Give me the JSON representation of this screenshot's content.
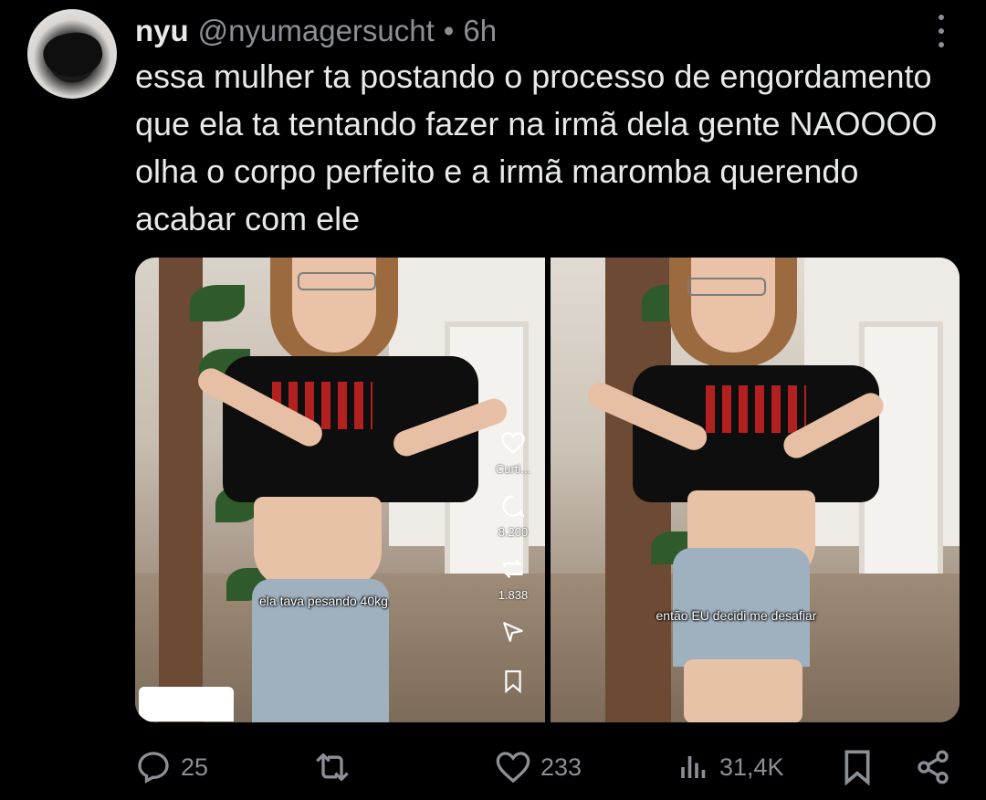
{
  "author": {
    "display_name": "nyu",
    "handle": "@nyumagersucht",
    "separator": "•",
    "time": "6h"
  },
  "tweet_text": "essa mulher ta postando o processo de engordamento que ela ta tentando fazer na irmã dela gente NAOOOO olha o corpo perfeito e a irmã maromba querendo acabar com ele",
  "media": {
    "left": {
      "caption": "ela tava pesando 40kg",
      "side_actions": [
        {
          "icon": "heart-icon",
          "label": "Curti..."
        },
        {
          "icon": "comment-icon",
          "label": "8.200"
        },
        {
          "icon": "repost-icon",
          "label": "1.838"
        },
        {
          "icon": "send-icon",
          "label": ""
        },
        {
          "icon": "bookmark-icon",
          "label": ""
        }
      ]
    },
    "right": {
      "caption": "então EU decidi me desafiar"
    }
  },
  "actions": {
    "replies": "25",
    "reposts": "",
    "likes": "233",
    "views": "31,4K"
  },
  "colors": {
    "background": "#000000",
    "text_primary": "#e7e9ea",
    "text_secondary": "#8b9096"
  }
}
